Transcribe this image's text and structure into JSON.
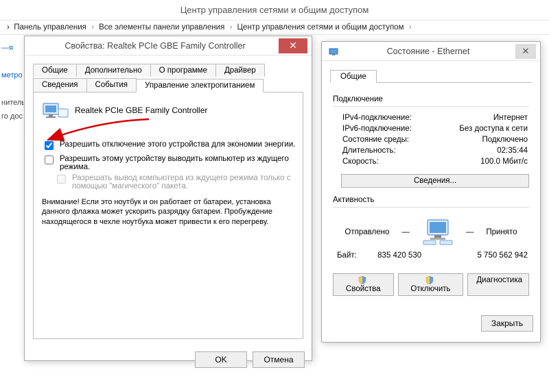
{
  "header": {
    "title": "Центр управления сетями и общим доступом"
  },
  "breadcrumb": {
    "items": [
      "Панель управления",
      "Все элементы панели управления",
      "Центр управления сетями и общим доступом"
    ]
  },
  "left_fragments": [
    "—я",
    "метро",
    "нитель",
    "го дос"
  ],
  "prop_dialog": {
    "title": "Свойства: Realtek PCIe GBE Family Controller",
    "tabs_row1": [
      "Общие",
      "Дополнительно",
      "О программе",
      "Драйвер"
    ],
    "tabs_row2": [
      "Сведения",
      "События",
      "Управление электропитанием"
    ],
    "active_tab": "Управление электропитанием",
    "device_name": "Realtek PCIe GBE Family Controller",
    "chk1": {
      "label": "Разрешить отключение этого устройства для экономии энергии.",
      "checked": true
    },
    "chk2": {
      "label": "Разрешить этому устройству выводить компьютер из ждущего режима.",
      "checked": false
    },
    "chk3": {
      "label": "Разрешать вывод компьютера из ждущего режима только с помощью \"магического\" пакета.",
      "checked": false,
      "disabled": true
    },
    "warning": "Внимание! Если это ноутбук и он работает от батареи, установка данного флажка может ускорить разрядку батареи. Пробуждение находящегося в чехле ноутбука может привести к его перегреву.",
    "ok": "OK",
    "cancel": "Отмена"
  },
  "status_dialog": {
    "title": "Состояние - Ethernet",
    "tab": "Общие",
    "section_conn": "Подключение",
    "conn": {
      "ipv4_k": "IPv4-подключение:",
      "ipv4_v": "Интернет",
      "ipv6_k": "IPv6-подключение:",
      "ipv6_v": "Без доступа к сети",
      "media_k": "Состояние среды:",
      "media_v": "Подключено",
      "dur_k": "Длительность:",
      "dur_v": "02:35:44",
      "speed_k": "Скорость:",
      "speed_v": "100.0 Мбит/с"
    },
    "details_btn": "Сведения...",
    "section_act": "Активность",
    "activity": {
      "sent_label": "Отправлено",
      "recv_label": "Принято",
      "bytes_label": "Байт:",
      "sent": "835 420 530",
      "recv": "5 750 562 942"
    },
    "btn_props": "Свойства",
    "btn_disable": "Отключить",
    "btn_diag": "Диагностика",
    "btn_close": "Закрыть"
  }
}
